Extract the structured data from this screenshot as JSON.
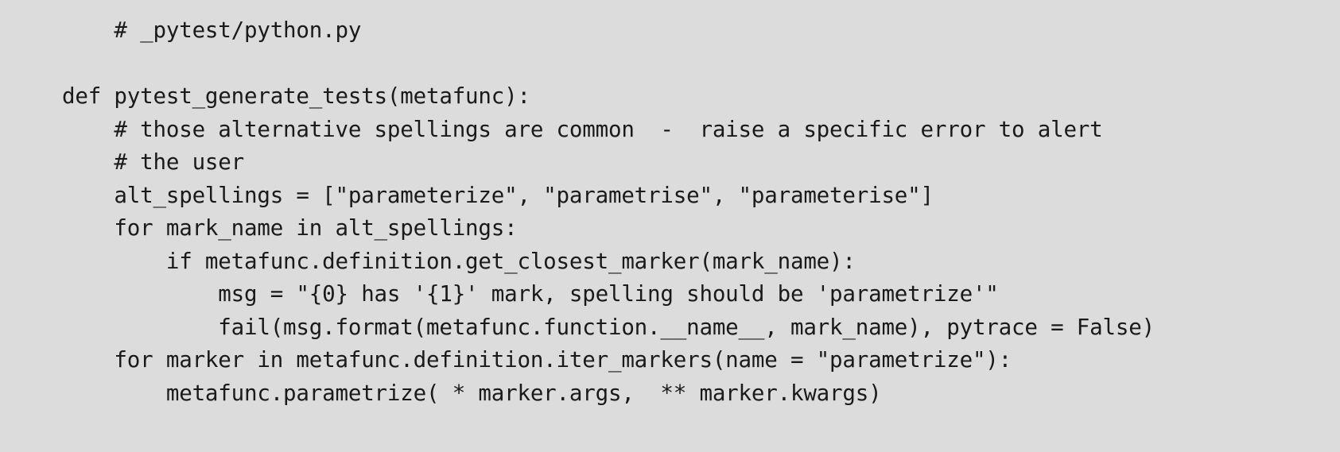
{
  "figure": {
    "kind": "source-code-listing",
    "language": "python",
    "background_color": "#dcdcdc",
    "text_color": "#1a1a1a",
    "has_syntax_highlighting": false,
    "has_line_numbers": false,
    "file_comment": "# _pytest/python.py"
  },
  "code": {
    "lines": [
      "    # _pytest/python.py",
      "",
      "def pytest_generate_tests(metafunc):",
      "    # those alternative spellings are common  -  raise a specific error to alert",
      "    # the user",
      "    alt_spellings = [\"parameterize\", \"parametrise\", \"parameterise\"]",
      "    for mark_name in alt_spellings:",
      "        if metafunc.definition.get_closest_marker(mark_name):",
      "            msg = \"{0} has '{1}' mark, spelling should be 'parametrize'\"",
      "            fail(msg.format(metafunc.function.__name__, mark_name), pytrace = False)",
      "    for marker in metafunc.definition.iter_markers(name = \"parametrize\"):",
      "        metafunc.parametrize( * marker.args,  ** marker.kwargs)"
    ],
    "line_count": 12,
    "function_name": "pytest_generate_tests",
    "identifiers": [
      "metafunc",
      "alt_spellings",
      "mark_name",
      "marker",
      "msg",
      "pytrace"
    ],
    "string_literals": [
      "parameterize",
      "parametrise",
      "parameterise",
      "{0} has '{1}' mark, spelling should be 'parametrize'",
      "parametrize"
    ],
    "keywords": [
      "def",
      "for",
      "in",
      "if"
    ],
    "comments": [
      "# _pytest/python.py",
      "# those alternative spellings are common  -  raise a specific error to alert",
      "# the user"
    ]
  }
}
